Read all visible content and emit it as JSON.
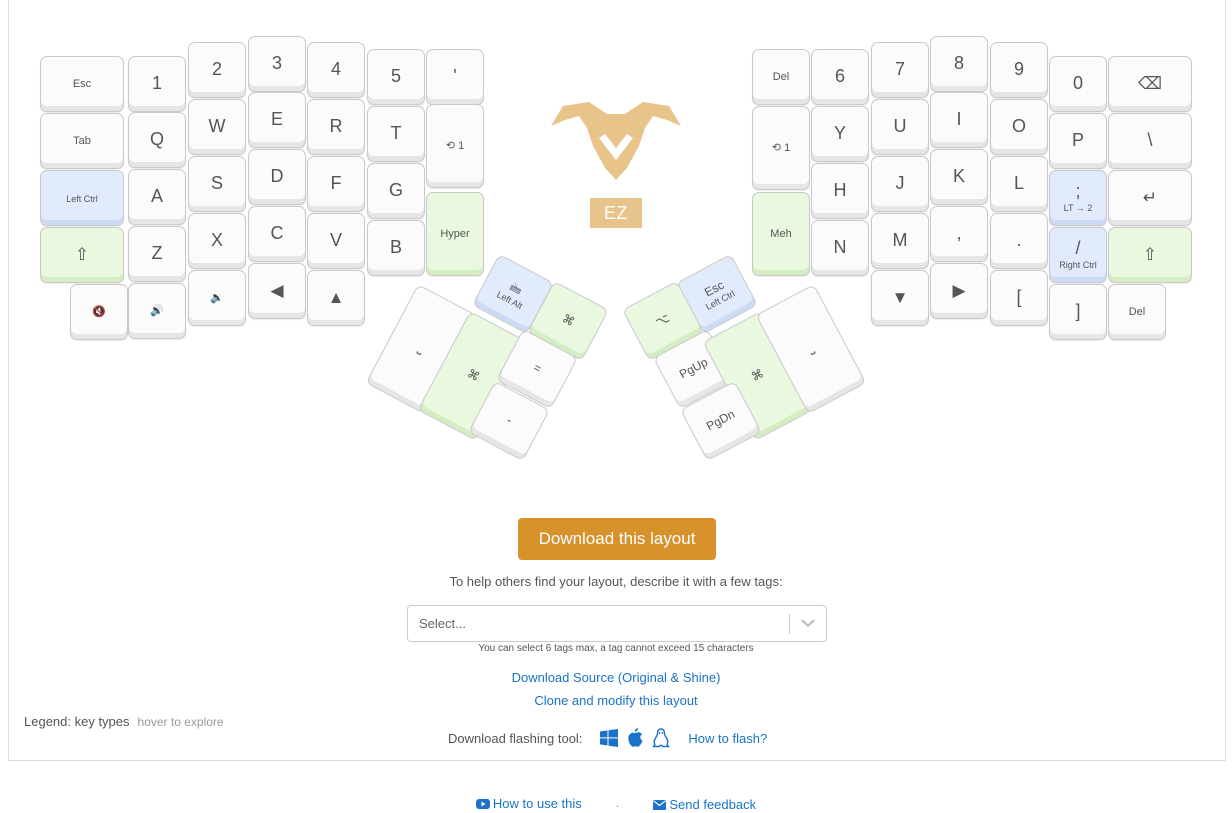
{
  "left_keys": [
    {
      "name": "key-esc",
      "label": "Esc",
      "cls": "small"
    },
    {
      "name": "key-1",
      "label": "1",
      "cls": "big"
    },
    {
      "name": "key-2",
      "label": "2",
      "cls": "big"
    },
    {
      "name": "key-3",
      "label": "3",
      "cls": "big"
    },
    {
      "name": "key-4",
      "label": "4",
      "cls": "big"
    },
    {
      "name": "key-5",
      "label": "5",
      "cls": "big"
    },
    {
      "name": "key-quote",
      "label": "'",
      "cls": "big"
    },
    {
      "name": "key-tab",
      "label": "Tab",
      "cls": "small"
    },
    {
      "name": "key-q",
      "label": "Q",
      "cls": "big"
    },
    {
      "name": "key-w",
      "label": "W",
      "cls": "big"
    },
    {
      "name": "key-e",
      "label": "E",
      "cls": "big"
    },
    {
      "name": "key-r",
      "label": "R",
      "cls": "big"
    },
    {
      "name": "key-t",
      "label": "T",
      "cls": "big"
    },
    {
      "name": "key-layer-toggle-left",
      "label": "⟲ 1",
      "cls": "small"
    },
    {
      "name": "key-left-ctrl",
      "label": "Left Ctrl",
      "cls": "tiny",
      "color": "blue"
    },
    {
      "name": "key-a",
      "label": "A",
      "cls": "big"
    },
    {
      "name": "key-s",
      "label": "S",
      "cls": "big"
    },
    {
      "name": "key-d",
      "label": "D",
      "cls": "big"
    },
    {
      "name": "key-f",
      "label": "F",
      "cls": "big"
    },
    {
      "name": "key-g",
      "label": "G",
      "cls": "big"
    },
    {
      "name": "key-hyper",
      "label": "Hyper",
      "cls": "small",
      "color": "green"
    },
    {
      "name": "key-left-shift",
      "label": "⇧",
      "cls": "glyph",
      "color": "green"
    },
    {
      "name": "key-z",
      "label": "Z",
      "cls": "big"
    },
    {
      "name": "key-x",
      "label": "X",
      "cls": "big"
    },
    {
      "name": "key-c",
      "label": "C",
      "cls": "big"
    },
    {
      "name": "key-v",
      "label": "V",
      "cls": "big"
    },
    {
      "name": "key-b",
      "label": "B",
      "cls": "big"
    },
    {
      "name": "key-mute",
      "label": "🔇",
      "cls": "small"
    },
    {
      "name": "key-volume-up",
      "label": "🔊",
      "cls": "small"
    },
    {
      "name": "key-volume-down",
      "label": "🔉",
      "cls": "small"
    },
    {
      "name": "key-arrow-left",
      "label": "◀",
      "cls": "glyph"
    },
    {
      "name": "key-arrow-up",
      "label": "▲",
      "cls": "glyph"
    }
  ],
  "right_keys": [
    {
      "name": "key-del-top",
      "label": "Del",
      "cls": "small"
    },
    {
      "name": "key-6",
      "label": "6",
      "cls": "big"
    },
    {
      "name": "key-7",
      "label": "7",
      "cls": "big"
    },
    {
      "name": "key-8",
      "label": "8",
      "cls": "big"
    },
    {
      "name": "key-9",
      "label": "9",
      "cls": "big"
    },
    {
      "name": "key-0",
      "label": "0",
      "cls": "big"
    },
    {
      "name": "key-backspace",
      "label": "⌫",
      "cls": "glyph"
    },
    {
      "name": "key-layer-toggle-right",
      "label": "⟲ 1",
      "cls": "small"
    },
    {
      "name": "key-y",
      "label": "Y",
      "cls": "big"
    },
    {
      "name": "key-u",
      "label": "U",
      "cls": "big"
    },
    {
      "name": "key-i",
      "label": "I",
      "cls": "big"
    },
    {
      "name": "key-o",
      "label": "O",
      "cls": "big"
    },
    {
      "name": "key-p",
      "label": "P",
      "cls": "big"
    },
    {
      "name": "key-backslash",
      "label": "\\",
      "cls": "big"
    },
    {
      "name": "key-meh",
      "label": "Meh",
      "cls": "small",
      "color": "green"
    },
    {
      "name": "key-h",
      "label": "H",
      "cls": "big"
    },
    {
      "name": "key-j",
      "label": "J",
      "cls": "big"
    },
    {
      "name": "key-k",
      "label": "K",
      "cls": "big"
    },
    {
      "name": "key-l",
      "label": "L",
      "cls": "big"
    },
    {
      "name": "key-semicolon",
      "label": ";",
      "sub": "LT → 2",
      "cls": "big",
      "color": "blue"
    },
    {
      "name": "key-enter",
      "label": "↵",
      "cls": "glyph"
    },
    {
      "name": "key-n",
      "label": "N",
      "cls": "big"
    },
    {
      "name": "key-m",
      "label": "M",
      "cls": "big"
    },
    {
      "name": "key-comma",
      "label": ",",
      "cls": "big"
    },
    {
      "name": "key-period",
      "label": ".",
      "cls": "big"
    },
    {
      "name": "key-slash",
      "label": "/",
      "sub": "Right Ctrl",
      "cls": "big",
      "color": "blue"
    },
    {
      "name": "key-right-shift",
      "label": "⇧",
      "cls": "glyph",
      "color": "green"
    },
    {
      "name": "key-arrow-down",
      "label": "▼",
      "cls": "glyph"
    },
    {
      "name": "key-arrow-right",
      "label": "▶",
      "cls": "glyph"
    },
    {
      "name": "key-left-bracket",
      "label": "[",
      "cls": "big"
    },
    {
      "name": "key-right-bracket",
      "label": "]",
      "cls": "big"
    },
    {
      "name": "key-del-bottom",
      "label": "Del",
      "cls": "small"
    }
  ],
  "thumb_keys": [
    {
      "name": "thumb-left-alt",
      "label": "🖮",
      "sub": "Left Alt",
      "color": "blue"
    },
    {
      "name": "thumb-left-cmd-small",
      "label": "⌘",
      "color": "green"
    },
    {
      "name": "thumb-left-space",
      "label": "⎵"
    },
    {
      "name": "thumb-left-cmd-big",
      "label": "⌘",
      "color": "green"
    },
    {
      "name": "thumb-left-equals",
      "label": "="
    },
    {
      "name": "thumb-left-minus",
      "label": "-"
    },
    {
      "name": "thumb-right-esc",
      "label": "Esc",
      "sub": "Left Ctrl",
      "color": "blue"
    },
    {
      "name": "thumb-right-alt-small",
      "label": "⌥",
      "color": "green"
    },
    {
      "name": "thumb-right-pgup",
      "label": "PgUp"
    },
    {
      "name": "thumb-right-cmd-big",
      "label": "⌘",
      "color": "green"
    },
    {
      "name": "thumb-right-enter",
      "label": "⎵"
    },
    {
      "name": "thumb-right-pgdn",
      "label": "PgDn"
    }
  ],
  "logo": {
    "badge": "EZ",
    "color": "#e8c48a"
  },
  "download_button": "Download this layout",
  "tags_help": "To help others find your layout, describe it with a few tags:",
  "tags_select": {
    "placeholder": "Select..."
  },
  "tags_note": "You can select 6 tags max, a tag cannot exceed 15 characters",
  "links": {
    "download_source": "Download Source (Original & Shine)",
    "clone": "Clone and modify this layout"
  },
  "legend": {
    "label": "Legend: key types",
    "hint": "hover to explore"
  },
  "flash": {
    "label": "Download flashing tool:",
    "howto": "How to flash?",
    "icons": [
      "windows-icon",
      "apple-icon",
      "linux-icon"
    ]
  },
  "footer": {
    "how_to_use": "How to use this",
    "send_feedback": "Send feedback"
  },
  "colors": {
    "accent": "#d8922c",
    "link": "#1a73c8",
    "green_key": "#e9f8df",
    "blue_key": "#e2ebfc"
  }
}
